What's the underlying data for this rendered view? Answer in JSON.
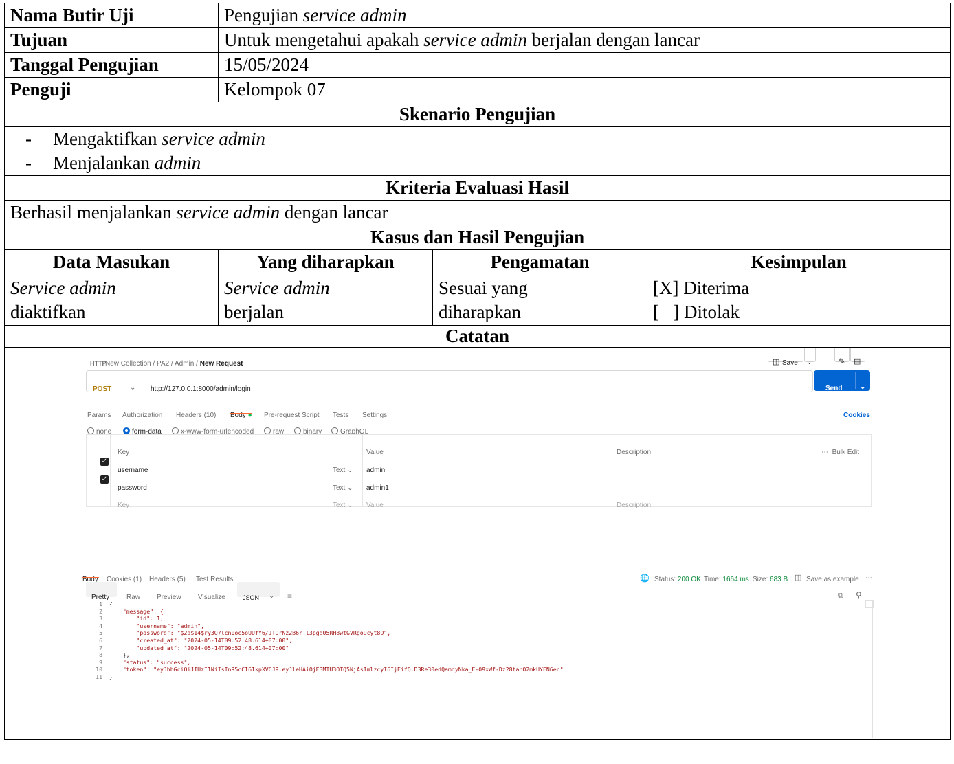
{
  "doc": {
    "rows": {
      "nama_label": "Nama Butir Uji",
      "nama_value_plain": "Pengujian ",
      "nama_value_italic": "service admin",
      "tujuan_label": "Tujuan",
      "tujuan_value_1": "Untuk mengetahui apakah ",
      "tujuan_value_italic": "service admin",
      "tujuan_value_2": " berjalan dengan lancar",
      "tanggal_label": "Tanggal Pengujian",
      "tanggal_value": "15/05/2024",
      "penguji_label": "Penguji",
      "penguji_value": "Kelompok 07"
    },
    "skenario_header": "Skenario Pengujian",
    "skenario": [
      {
        "plain": "Mengaktifkan ",
        "italic": "service admin"
      },
      {
        "plain": "Menjalankan ",
        "italic": "admin"
      }
    ],
    "dash": "-",
    "kriteria_header": "Kriteria Evaluasi Hasil",
    "kriteria_plain_1": "Berhasil menjalankan ",
    "kriteria_italic": "service admin",
    "kriteria_plain_2": " dengan lancar",
    "kasus_header": "Kasus dan Hasil Pengujian",
    "columns": [
      "Data Masukan",
      "Yang diharapkan",
      "Pengamatan",
      "Kesimpulan"
    ],
    "case": {
      "input_1": "Service admin",
      "input_2": "diaktifkan",
      "expected_1": "Service admin",
      "expected_2": "berjalan",
      "observed_1": "Sesuai yang",
      "observed_2": "diharapkan",
      "result_1": "[X] Diterima",
      "result_2": "[   ] Ditolak"
    },
    "catatan_header": "Catatan"
  },
  "postman": {
    "breadcrumb": [
      "New Collection",
      "PA2",
      "Admin",
      "New Request"
    ],
    "breadcrumb_sep": "/",
    "save_label": "Save",
    "method": "POST",
    "url": "http://127.0.0.1:8000/admin/login",
    "send_label": "Send",
    "request_tabs": [
      "Params",
      "Authorization",
      "Headers (10)",
      "Body",
      "Pre-request Script",
      "Tests",
      "Settings"
    ],
    "cookies_link": "Cookies",
    "body_types": [
      "none",
      "form-data",
      "x-www-form-urlencoded",
      "raw",
      "binary",
      "GraphQL"
    ],
    "kv_headers": {
      "key": "Key",
      "value": "Value",
      "description": "Description",
      "bulk_edit": "Bulk Edit"
    },
    "kv_rows": [
      {
        "key": "username",
        "type": "Text",
        "value": "admin"
      },
      {
        "key": "password",
        "type": "Text",
        "value": "admin1"
      }
    ],
    "kv_placeholder": {
      "key": "Key",
      "type": "Text",
      "value": "Value",
      "description": "Description"
    },
    "response_tabs": [
      "Body",
      "Cookies (1)",
      "Headers (5)",
      "Test Results"
    ],
    "status_label": "Status:",
    "status_value": "200 OK",
    "time_label": "Time:",
    "time_value": "1664 ms",
    "size_label": "Size:",
    "size_value": "683 B",
    "save_example": "Save as example",
    "view_tabs": [
      "Pretty",
      "Raw",
      "Preview",
      "Visualize"
    ],
    "format": "JSON",
    "code_lines": [
      "{",
      "    \"message\": {",
      "        \"id\": 1,",
      "        \"username\": \"admin\",",
      "        \"password\": \"$2a$14$ry3O7lcn0oc5oUUfY6/JTOrNz2B6rTl3pgd05RH8wtGVRgoDcyt8O\",",
      "        \"created_at\": \"2024-05-14T09:52:48.614+07:00\",",
      "        \"updated_at\": \"2024-05-14T09:52:48.614+07:00\"",
      "    },",
      "    \"status\": \"success\",",
      "    \"token\": \"eyJhbGciOiJIUzI1NiIsInR5cCI6IkpXVCJ9.eyJleHAiOjE3MTU3OTQ5NjAsImlzcyI6IjEifQ.D3Re30edQamdyNka_E-09xWf-Dz28tahO2mkUYEN6ec\"",
      "}"
    ]
  }
}
